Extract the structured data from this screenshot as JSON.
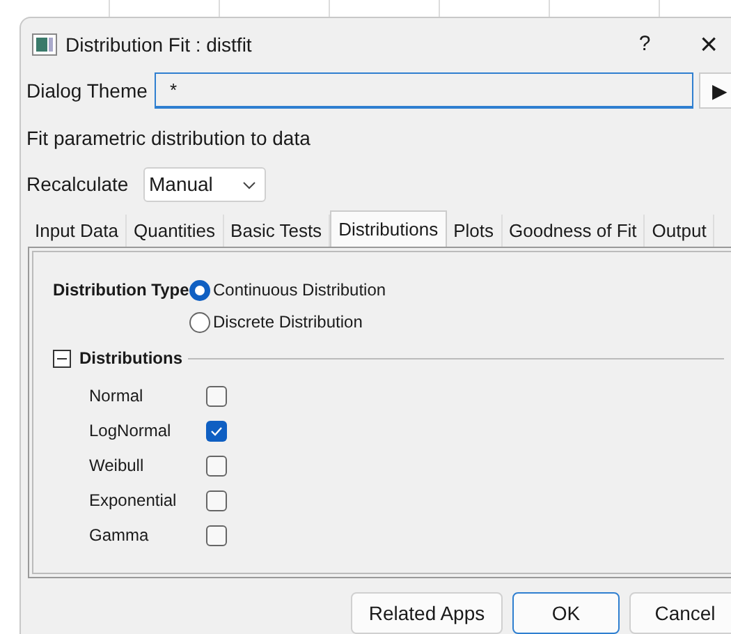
{
  "window": {
    "title": "Distribution Fit : distfit"
  },
  "title_buttons": [
    "?",
    "×"
  ],
  "dialog_theme": {
    "label": "Dialog Theme",
    "value": "*",
    "button": "▶"
  },
  "description": "Fit parametric distribution to data",
  "recalculate": {
    "label": "Recalculate",
    "value": "Manual"
  },
  "tabs": [
    {
      "label": "Input Data",
      "selected": false
    },
    {
      "label": "Quantities",
      "selected": false
    },
    {
      "label": "Basic Tests",
      "selected": false
    },
    {
      "label": "Distributions",
      "selected": true
    },
    {
      "label": "Plots",
      "selected": false
    },
    {
      "label": "Goodness of Fit",
      "selected": false
    },
    {
      "label": "Output",
      "selected": false
    }
  ],
  "distribution_type": {
    "label": "Distribution Type",
    "options": [
      {
        "label": "Continuous Distribution",
        "selected": true
      },
      {
        "label": "Discrete Distribution",
        "selected": false
      }
    ]
  },
  "distributions": {
    "label": "Distributions",
    "expanded": true,
    "items": [
      {
        "label": "Normal",
        "checked": false
      },
      {
        "label": "LogNormal",
        "checked": true
      },
      {
        "label": "Weibull",
        "checked": false
      },
      {
        "label": "Exponential",
        "checked": false
      },
      {
        "label": "Gamma",
        "checked": false
      }
    ]
  },
  "buttons": [
    "Related Apps",
    "OK",
    "Cancel"
  ]
}
